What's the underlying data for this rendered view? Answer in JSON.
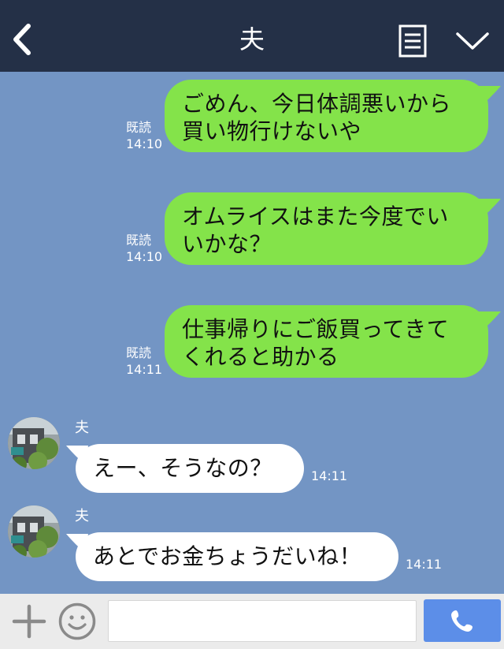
{
  "header": {
    "title": "夫",
    "back_icon": "chevron-left-icon",
    "notes_icon": "notes-icon",
    "menu_icon": "chevron-down-icon",
    "background_color": "#243047"
  },
  "chat": {
    "background_color": "#7395c4",
    "outgoing": [
      {
        "text": "ごめん、今日体調悪いから\n買い物行けないや",
        "read": "既読",
        "time": "14:10"
      },
      {
        "text": "オムライスはまた今度でい\nいかな？",
        "read": "既読",
        "time": "14:10"
      },
      {
        "text": "仕事帰りにご飯買ってきて\nくれると助かる",
        "read": "既読",
        "time": "14:11"
      }
    ],
    "incoming": [
      {
        "sender": "夫",
        "text": "えー、そうなの？",
        "time": "14:11"
      },
      {
        "sender": "夫",
        "text": "あとでお金ちょうだいね！",
        "time": "14:11"
      }
    ],
    "outgoing_bubble_color": "#84e34a",
    "incoming_bubble_color": "#ffffff"
  },
  "footer": {
    "plus_icon": "plus-icon",
    "emoji_icon": "smiley-icon",
    "input_value": "",
    "call_icon": "phone-icon",
    "call_button_color": "#5c8ee8"
  }
}
